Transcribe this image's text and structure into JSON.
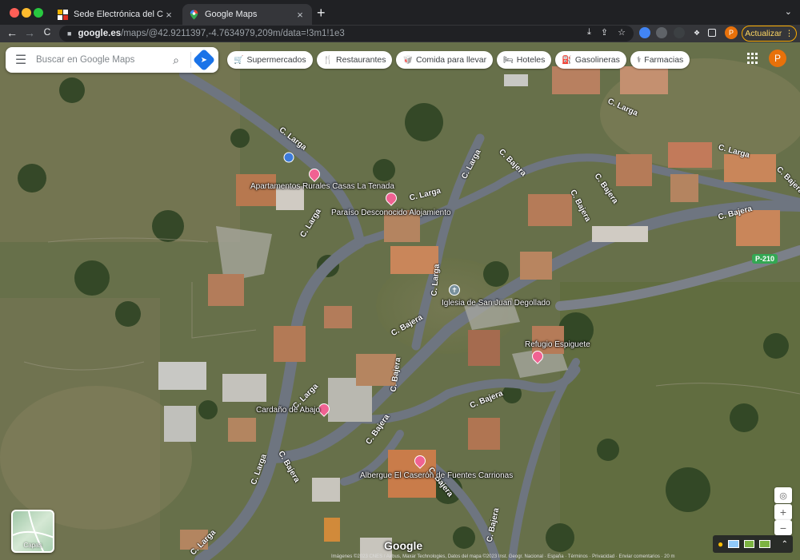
{
  "browser": {
    "tabs": [
      {
        "title": "Sede Electrónica del Catastro",
        "active": false,
        "favicon": "catastro-icon"
      },
      {
        "title": "Google Maps",
        "active": true,
        "favicon": "maps-pin-icon"
      }
    ],
    "close_glyph": "×",
    "new_tab_glyph": "+",
    "tab_menu_glyph": "⌄",
    "nav": {
      "back": "←",
      "forward": "→",
      "reload": "C"
    },
    "url_host": "google.es",
    "url_path": "/maps/@42.9211397,-4.7634979,209m/data=!3m1!1e3",
    "omni_icons": [
      "⤓",
      "⇪",
      "☆"
    ],
    "profile_initial": "P",
    "update_label": "Actualizar",
    "update_menu": "⋮"
  },
  "maps": {
    "search": {
      "placeholder": "Buscar en Google Maps",
      "menu": "☰",
      "search_glyph": "⌕",
      "directions_glyph": "➤"
    },
    "chips": [
      {
        "label": "Supermercados",
        "icon": "🛒"
      },
      {
        "label": "Restaurantes",
        "icon": "🍴"
      },
      {
        "label": "Comida para llevar",
        "icon": "🥡"
      },
      {
        "label": "Hoteles",
        "icon": "🛏"
      },
      {
        "label": "Gasolineras",
        "icon": "⛽"
      },
      {
        "label": "Farmacias",
        "icon": "⚕"
      }
    ],
    "account_initial": "P",
    "layers_label": "Capas",
    "google_logo": "Google",
    "street_labels": [
      "C. Larga",
      "C. Larga",
      "C. Larga",
      "C. Bajera",
      "C. Larga",
      "C. Bajera",
      "C. Bajera",
      "C. Bajera",
      "C. Bajera",
      "C. Larga",
      "C. Bajera",
      "C. Bajera",
      "C. Larga",
      "C. Bajera",
      "C. Bajera",
      "C. Larga",
      "C. Larga",
      "C. Bajera",
      "C. Larga",
      "C. Bajera",
      "C. Larga",
      "C. Bajera"
    ],
    "pois": [
      {
        "name": "Apartamentos Rurales Casas La Tenada"
      },
      {
        "name": "Paraíso Desconocido Alojamiento"
      },
      {
        "name": "Iglesia de San Juan Degollado"
      },
      {
        "name": "Refugio Espiguete"
      },
      {
        "name": "Cardaño de Abajo"
      },
      {
        "name": "Albergue El Caserón de Fuentes Carrionas"
      }
    ],
    "road_shield": "P-210",
    "zoom_in": "+",
    "zoom_out": "−",
    "locate_glyph": "◎",
    "attribution": "Imágenes ©2023 CNES / Airbus, Maxar Technologies, Datos del mapa ©2023 Inst. Geogr. Nacional · España · Términos · Privacidad · Enviar comentarios · 20 m"
  }
}
